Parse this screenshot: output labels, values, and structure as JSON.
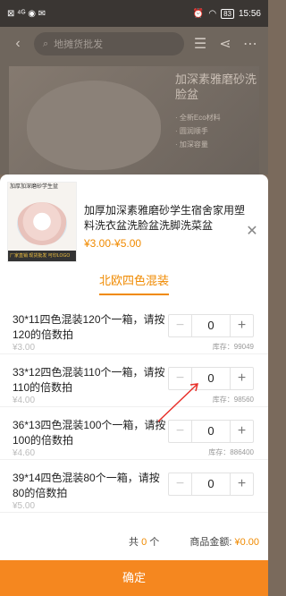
{
  "status_bar": {
    "left_icons": "⊠ ⁴ᴳ ◉ ✉",
    "time": "15:56",
    "battery": "83"
  },
  "background_page": {
    "search_placeholder": "地摊货批发",
    "promo_title": "加深素雅磨砂洗脸盆",
    "promo_features": [
      "· 全新Eco材料",
      "· 圆润顺手",
      "· 加深容量"
    ]
  },
  "product": {
    "thumb_top": "加厚加深磨砂学生盆",
    "thumb_tags": "厂家直销 现货批发 可印LOGO",
    "name": "加厚加深素雅磨砂学生宿舍家用塑料洗衣盆洗脸盆洗脚洗菜盆",
    "price": "¥3.00-¥5.00"
  },
  "variant_tab": "北欧四色混装",
  "variants": [
    {
      "name": "30*11四色混装120个一箱，请按120的倍数拍",
      "price": "¥3.00",
      "qty": "0",
      "stock": "库存：99049"
    },
    {
      "name": "33*12四色混装110个一箱，请按110的倍数拍",
      "price": "¥4.00",
      "qty": "0",
      "stock": "库存：98560"
    },
    {
      "name": "36*13四色混装100个一箱，请按100的倍数拍",
      "price": "¥4.60",
      "qty": "0",
      "stock": "库存：886400"
    },
    {
      "name": "39*14四色混装80个一箱，请按80的倍数拍",
      "price": "¥5.00",
      "qty": "0",
      "stock": ""
    }
  ],
  "summary": {
    "count_prefix": "共",
    "count_value": "0",
    "count_suffix": "个",
    "amount_label": "商品金额:",
    "amount_value": "¥0.00"
  },
  "confirm_label": "确定",
  "icons": {
    "back": "‹",
    "search": "⌕",
    "list": "☰",
    "share": "⋖",
    "more": "⋯",
    "close": "✕",
    "minus": "−",
    "plus": "+"
  },
  "colors": {
    "accent": "#f08a00",
    "confirm_bg": "#f5871f",
    "annotation": "#e8302a"
  }
}
